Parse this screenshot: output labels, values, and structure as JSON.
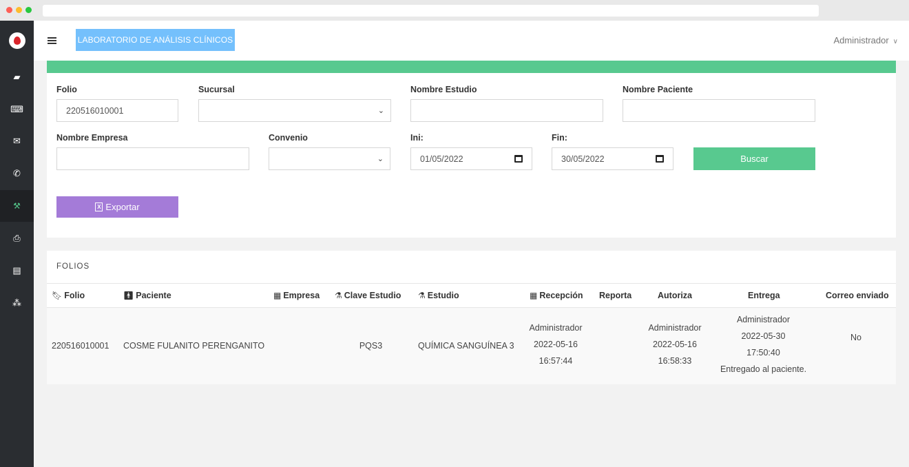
{
  "sidebar": {
    "items": [
      {
        "icon": "book-icon",
        "glyph": "▰"
      },
      {
        "icon": "keyboard-icon",
        "glyph": "⌨"
      },
      {
        "icon": "envelope-icon",
        "glyph": "✉"
      },
      {
        "icon": "whatsapp-icon",
        "glyph": "✆"
      },
      {
        "icon": "wrench-icon",
        "glyph": "🔧"
      },
      {
        "icon": "print-icon",
        "glyph": "⎙"
      },
      {
        "icon": "file-icon",
        "glyph": "▤"
      },
      {
        "icon": "cubes-icon",
        "glyph": "⁂"
      }
    ],
    "active_index": 4
  },
  "header": {
    "lab_button": "LABORATORIO DE ANÁLISIS CLÍNICOS",
    "user": "Administrador"
  },
  "filters": {
    "folio_label": "Folio",
    "folio_value": "220516010001",
    "sucursal_label": "Sucursal",
    "sucursal_value": "",
    "nombre_estudio_label": "Nombre Estudio",
    "nombre_estudio_value": "",
    "nombre_paciente_label": "Nombre Paciente",
    "nombre_paciente_value": "",
    "nombre_empresa_label": "Nombre Empresa",
    "nombre_empresa_value": "",
    "convenio_label": "Convenio",
    "convenio_value": "",
    "ini_label": "Ini:",
    "ini_value": "01/05/2022",
    "fin_label": "Fin:",
    "fin_value": "30/05/2022",
    "buscar_label": "Buscar",
    "exportar_label": "Exportar"
  },
  "table": {
    "title": "FOLIOS",
    "columns": {
      "folio": "Folio",
      "paciente": "Paciente",
      "empresa": "Empresa",
      "clave_estudio": "Clave Estudio",
      "estudio": "Estudio",
      "recepcion": "Recepción",
      "reporta": "Reporta",
      "autoriza": "Autoriza",
      "entrega": "Entrega",
      "correo": "Correo enviado"
    },
    "rows": [
      {
        "folio": "220516010001",
        "paciente": "COSME FULANITO PERENGANITO",
        "empresa": "",
        "clave_estudio": "PQS3",
        "estudio": "QUÍMICA SANGUÍNEA 3",
        "recepcion_user": "Administrador",
        "recepcion_date": "2022-05-16",
        "recepcion_time": "16:57:44",
        "reporta": "",
        "autoriza_user": "Administrador",
        "autoriza_date": "2022-05-16",
        "autoriza_time": "16:58:33",
        "entrega_user": "Administrador",
        "entrega_date": "2022-05-30",
        "entrega_time": "17:50:40",
        "entrega_status": "Entregado al paciente.",
        "correo": "No"
      }
    ]
  },
  "colors": {
    "sidebar": "#2a2d31",
    "accent_green": "#58c98f",
    "lab_button": "#74c0fc",
    "export_button": "#a47bd8"
  }
}
